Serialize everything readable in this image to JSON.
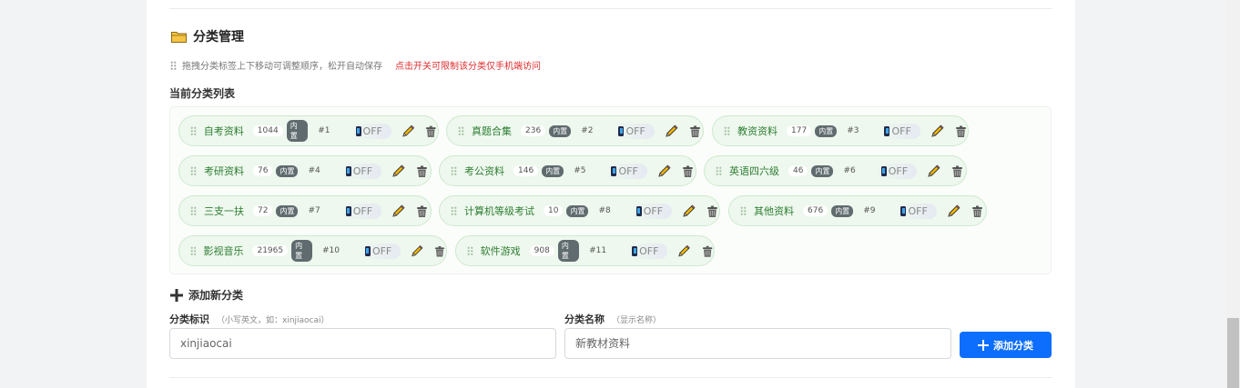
{
  "section": {
    "title": "分类管理",
    "hint": "拖拽分类标签上下移动可调整顺序，松开自动保存",
    "hint_red": "点击开关可限制该分类仅手机端访问",
    "list_title": "当前分类列表"
  },
  "categories": [
    {
      "name": "自考资料",
      "count": "1044",
      "badge": "内置",
      "order": "#1",
      "toggle": "OFF"
    },
    {
      "name": "真题合集",
      "count": "236",
      "badge": "内置",
      "order": "#2",
      "toggle": "OFF"
    },
    {
      "name": "教资资料",
      "count": "177",
      "badge": "内置",
      "order": "#3",
      "toggle": "OFF"
    },
    {
      "name": "考研资料",
      "count": "76",
      "badge": "内置",
      "order": "#4",
      "toggle": "OFF"
    },
    {
      "name": "考公资料",
      "count": "146",
      "badge": "内置",
      "order": "#5",
      "toggle": "OFF"
    },
    {
      "name": "英语四六级",
      "count": "46",
      "badge": "内置",
      "order": "#6",
      "toggle": "OFF"
    },
    {
      "name": "三支一扶",
      "count": "72",
      "badge": "内置",
      "order": "#7",
      "toggle": "OFF"
    },
    {
      "name": "计算机等级考试",
      "count": "10",
      "badge": "内置",
      "order": "#8",
      "toggle": "OFF"
    },
    {
      "name": "其他资料",
      "count": "676",
      "badge": "内置",
      "order": "#9",
      "toggle": "OFF"
    },
    {
      "name": "影视音乐",
      "count": "21965",
      "badge": "内置",
      "order": "#10",
      "toggle": "OFF"
    },
    {
      "name": "软件游戏",
      "count": "908",
      "badge": "内置",
      "order": "#11",
      "toggle": "OFF"
    }
  ],
  "add": {
    "title": "添加新分类",
    "key_label": "分类标识",
    "key_hint": "（小写英文，如：xinjiaocai）",
    "key_placeholder": "xinjiaocai",
    "name_label": "分类名称",
    "name_hint": "（显示名称）",
    "name_placeholder": "新教材资料",
    "button_label": "添加分类"
  },
  "colors": {
    "chip_bg": "#eef8ee",
    "chip_text": "#2e7d32",
    "accent": "#0d6efd",
    "hint_red": "#e02d2d"
  }
}
